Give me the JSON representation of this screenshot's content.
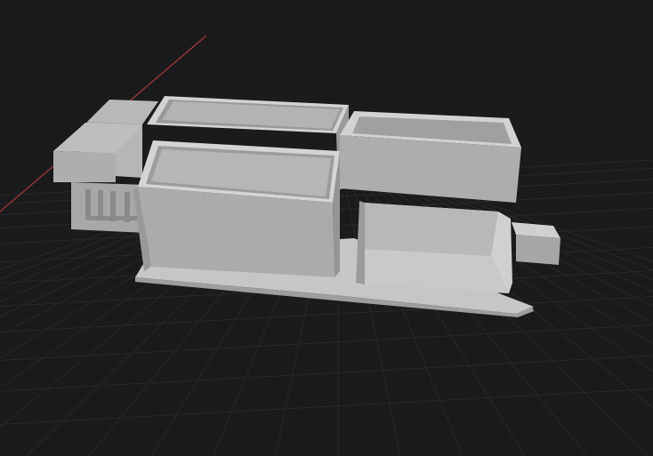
{
  "viewport": {
    "background": "#1b1b1d",
    "grid_line_color": "#2c2c2f",
    "axis_x_color": "#a33a3a"
  },
  "model": {
    "face_top": "#cfcfcf",
    "face_front": "#a9a9a9",
    "face_side": "#969696",
    "face_inner": "#8c8c8c",
    "base_plate": "#c4c4c4"
  }
}
